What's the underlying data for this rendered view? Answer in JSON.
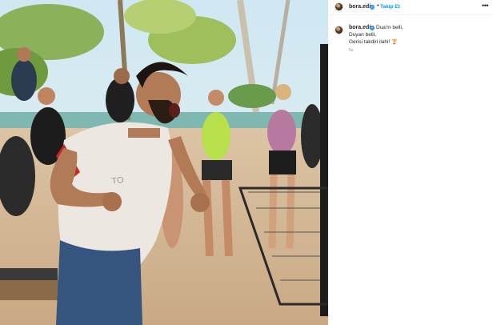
{
  "post": {
    "username": "bora.edin",
    "verified_mark": "✓",
    "follow_label": "Takip Et",
    "separator": "•",
    "more_icon": "•••"
  },
  "caption": {
    "username": "bora.edin",
    "lines": [
      "Dua'm belli,",
      "Duyan belli,",
      "Gerisi takdiri ilahi!"
    ],
    "emoji": "🏆",
    "time": "5s"
  },
  "colors": {
    "link": "#0095f6",
    "verified": "#3897f0",
    "text": "#262626",
    "muted": "#8e8e8e"
  }
}
